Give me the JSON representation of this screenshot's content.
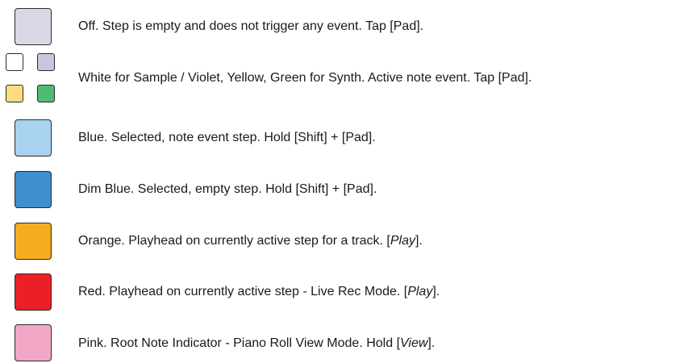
{
  "legend": {
    "rows": [
      {
        "id": "off",
        "color": "#d8d8e6",
        "text_before": "Off. Step is empty and does not trigger any event. Tap [Pad].",
        "emphasis": "",
        "text_after": ""
      },
      {
        "id": "active-note",
        "colors": {
          "white": "#ffffff",
          "violet": "#cbc4e0",
          "yellow": "#fddc81",
          "green": "#4dbd74"
        },
        "text_before": "White for Sample / Violet, Yellow, Green for Synth. Active note event. Tap [Pad].",
        "emphasis": "",
        "text_after": ""
      },
      {
        "id": "blue",
        "color": "#a9d1f0",
        "text_before": "Blue. Selected, note event step. Hold [Shift] + [Pad].",
        "emphasis": "",
        "text_after": ""
      },
      {
        "id": "dim-blue",
        "color": "#3f8fcf",
        "text_before": "Dim Blue. Selected, empty step. Hold [Shift] + [Pad].",
        "emphasis": "",
        "text_after": ""
      },
      {
        "id": "orange",
        "color": "#f4ad1f",
        "text_before": "Orange. Playhead on currently active step for a track. [",
        "emphasis": "Play",
        "text_after": "]."
      },
      {
        "id": "red",
        "color": "#ea1f27",
        "text_before": "Red. Playhead on currently active step - Live Rec Mode. [",
        "emphasis": "Play",
        "text_after": "]."
      },
      {
        "id": "pink",
        "color": "#f2a7c7",
        "text_before": "Pink. Root Note Indicator - Piano Roll View Mode. Hold [",
        "emphasis": "View",
        "text_after": "]."
      }
    ]
  }
}
